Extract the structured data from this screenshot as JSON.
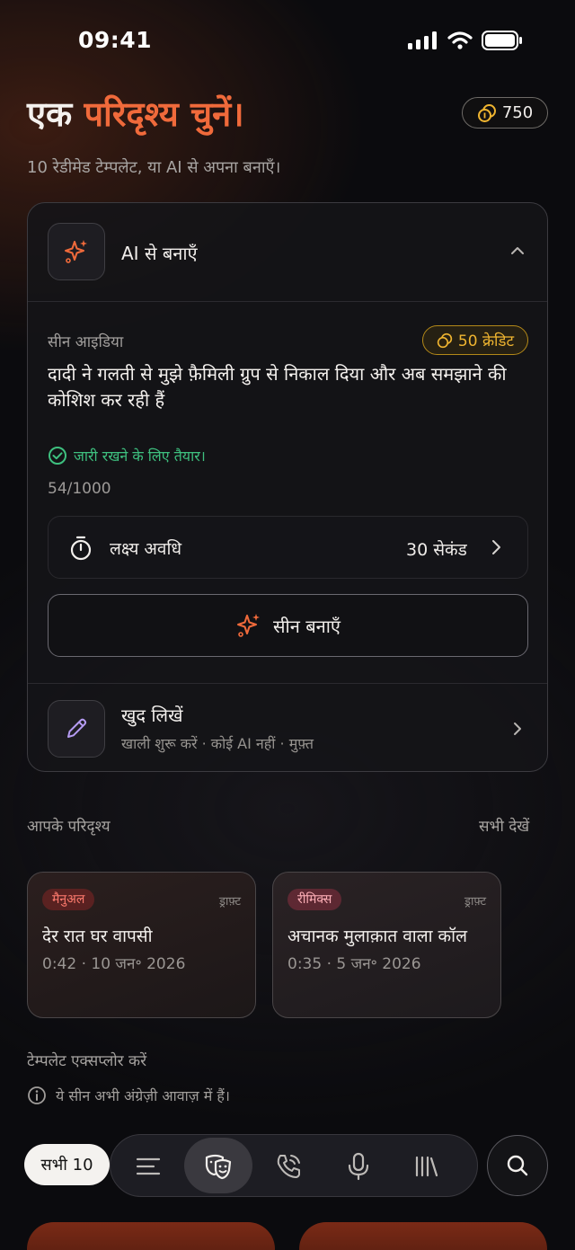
{
  "status_bar": {
    "time": "09:41"
  },
  "header": {
    "title_plain": "एक ",
    "title_accent": "परिदृश्य चुनें।",
    "subtitle": "10 रेडीमेड टेम्पलेट, या AI से अपना बनाएँ।",
    "credits": "750"
  },
  "ai_card": {
    "title": "AI से बनाएँ",
    "idea_label": "सीन आइडिया",
    "credit_cost": "50 क्रेडिट",
    "idea_text": "दादी ने गलती से मुझे फ़ैमिली ग्रुप से निकाल दिया और अब समझाने की कोशिश कर रही हैं",
    "ready_text": "जारी रखने के लिए तैयार।",
    "char_count": "54/1000",
    "duration_label": "लक्ष्य अवधि",
    "duration_value": "30 सेकंड",
    "create_button": "सीन बनाएँ",
    "write_title": "खुद लिखें",
    "write_subtitle": "खाली शुरू करें · कोई AI नहीं · मुफ़्त"
  },
  "scenarios": {
    "label": "आपके परिदृश्य",
    "see_all": "सभी देखें",
    "items": [
      {
        "tag": "मैनुअल",
        "status": "ड्राफ़्ट",
        "title": "देर रात घर वापसी",
        "meta": "0:42 · 10 जन॰ 2026"
      },
      {
        "tag": "रीमिक्स",
        "status": "ड्राफ़्ट",
        "title": "अचानक मुलाक़ात वाला कॉल",
        "meta": "0:35 · 5 जन॰ 2026"
      }
    ]
  },
  "templates": {
    "label": "टेम्पलेट एक्सप्लोर करें",
    "info": "ये सीन अभी अंग्रेज़ी आवाज़ में हैं।"
  },
  "bottom_bar": {
    "all_label": "सभी 10",
    "nav_icons": [
      "list-icon",
      "theater-masks-icon",
      "phone-call-icon",
      "microphone-icon",
      "library-icon"
    ],
    "active_index": 1
  },
  "colors": {
    "accent": "#f06a3b",
    "credit_gold": "#f0b530",
    "success": "#3ec07f",
    "background": "#0b0b0e"
  }
}
